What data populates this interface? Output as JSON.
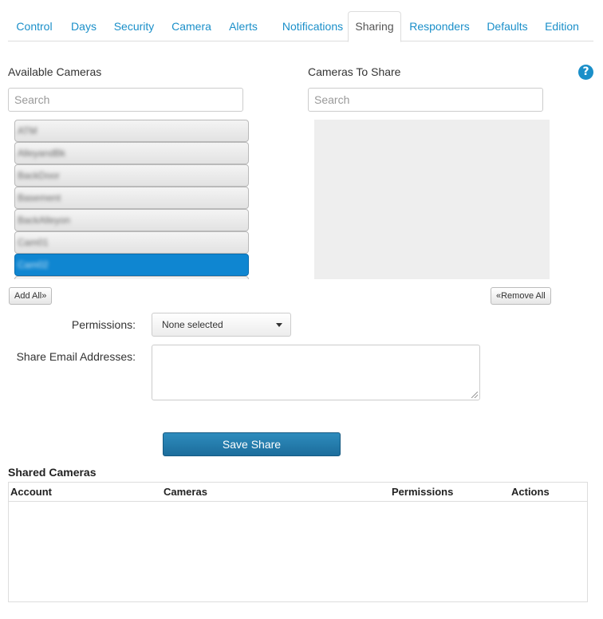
{
  "tabs": [
    {
      "label": "Control"
    },
    {
      "label": "Days"
    },
    {
      "label": "Security"
    },
    {
      "label": "Camera"
    },
    {
      "label": "Alerts"
    },
    {
      "label": "Notifications"
    },
    {
      "label": "Sharing"
    },
    {
      "label": "Responders"
    },
    {
      "label": "Defaults"
    },
    {
      "label": "Edition"
    }
  ],
  "active_tab": "Sharing",
  "available": {
    "heading": "Available Cameras",
    "search_placeholder": "Search",
    "items": [
      {
        "label": "ATM"
      },
      {
        "label": "AlleyandBk"
      },
      {
        "label": "BackDoor"
      },
      {
        "label": "Basement"
      },
      {
        "label": "BackAlleyon"
      },
      {
        "label": "Cam01"
      },
      {
        "label": "Cam02"
      }
    ],
    "selected_index": 6,
    "add_all_label": "Add All»"
  },
  "to_share": {
    "heading": "Cameras To Share",
    "search_placeholder": "Search",
    "remove_all_label": "«Remove All"
  },
  "help_icon": "?",
  "form": {
    "permissions_label": "Permissions:",
    "permissions_value": "None selected",
    "email_label": "Share Email Addresses:",
    "email_value": "",
    "save_label": "Save Share"
  },
  "shared": {
    "title": "Shared Cameras",
    "columns": [
      "Account",
      "Cameras",
      "Permissions",
      "Actions"
    ],
    "rows": []
  },
  "colors": {
    "accent": "#1a8fc9",
    "selected": "#0f86d1",
    "save_button": "#2479aa"
  }
}
